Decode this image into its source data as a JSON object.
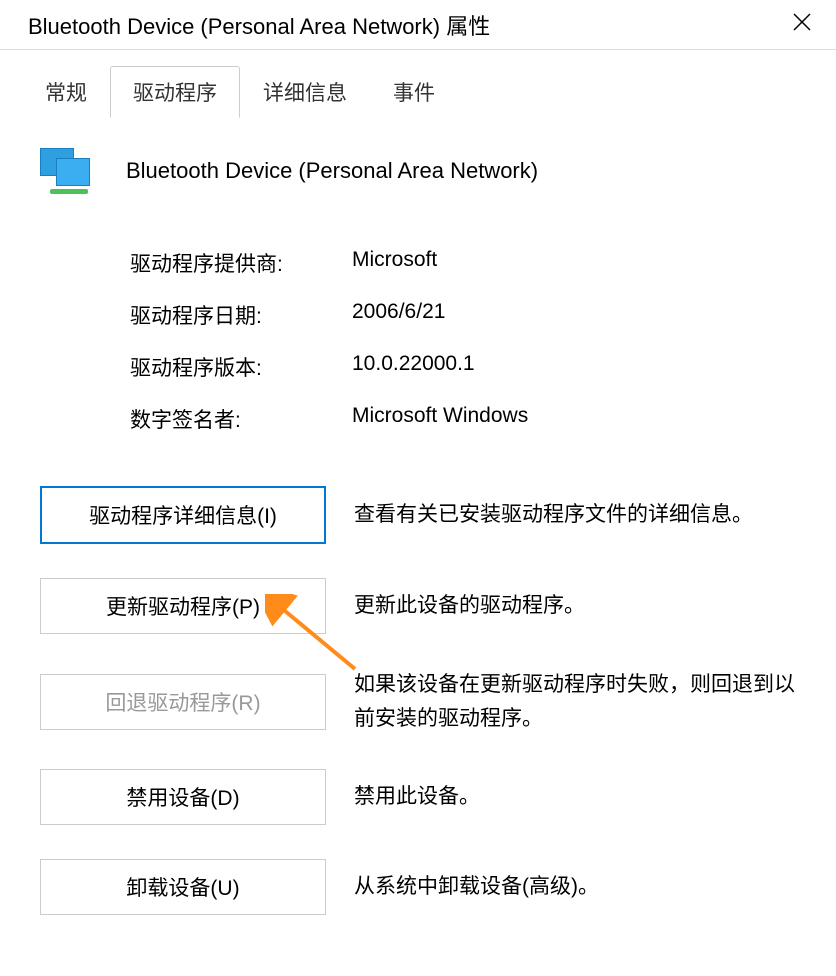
{
  "titlebar": {
    "title": "Bluetooth Device (Personal Area Network) 属性"
  },
  "tabs": {
    "items": [
      {
        "label": "常规",
        "selected": false
      },
      {
        "label": "驱动程序",
        "selected": true
      },
      {
        "label": "详细信息",
        "selected": false
      },
      {
        "label": "事件",
        "selected": false
      }
    ]
  },
  "device": {
    "name": "Bluetooth Device (Personal Area Network)"
  },
  "info": {
    "rows": [
      {
        "label": "驱动程序提供商:",
        "value": "Microsoft"
      },
      {
        "label": "驱动程序日期:",
        "value": "2006/6/21"
      },
      {
        "label": "驱动程序版本:",
        "value": "10.0.22000.1"
      },
      {
        "label": "数字签名者:",
        "value": "Microsoft Windows"
      }
    ]
  },
  "actions": {
    "rows": [
      {
        "button": "驱动程序详细信息(I)",
        "desc": "查看有关已安装驱动程序文件的详细信息。",
        "focused": true,
        "disabled": false
      },
      {
        "button": "更新驱动程序(P)",
        "desc": "更新此设备的驱动程序。",
        "focused": false,
        "disabled": false
      },
      {
        "button": "回退驱动程序(R)",
        "desc": "如果该设备在更新驱动程序时失败，则回退到以前安装的驱动程序。",
        "focused": false,
        "disabled": true
      },
      {
        "button": "禁用设备(D)",
        "desc": "禁用此设备。",
        "focused": false,
        "disabled": false
      },
      {
        "button": "卸载设备(U)",
        "desc": "从系统中卸载设备(高级)。",
        "focused": false,
        "disabled": false
      }
    ]
  }
}
